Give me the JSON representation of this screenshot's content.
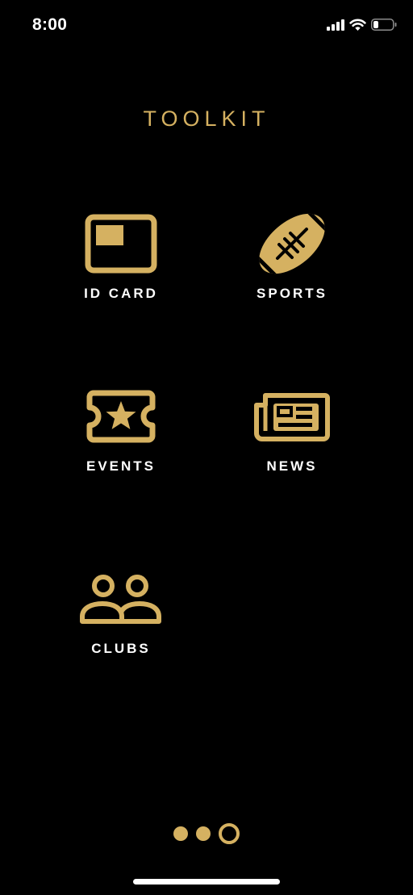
{
  "status_bar": {
    "time": "8:00",
    "icons": [
      "cellular-signal-icon",
      "wifi-icon",
      "battery-icon"
    ]
  },
  "title": "TOOLKIT",
  "colors": {
    "accent": "#d5b161",
    "background": "#000000",
    "label": "#ffffff"
  },
  "tools": {
    "id_card": {
      "label": "ID CARD",
      "icon": "id-card-icon"
    },
    "sports": {
      "label": "SPORTS",
      "icon": "football-icon"
    },
    "events": {
      "label": "EVENTS",
      "icon": "ticket-icon"
    },
    "news": {
      "label": "NEWS",
      "icon": "newspaper-icon"
    },
    "clubs": {
      "label": "CLUBS",
      "icon": "people-icon"
    }
  },
  "pagination": {
    "total_pages": 3,
    "current_page": 3
  }
}
